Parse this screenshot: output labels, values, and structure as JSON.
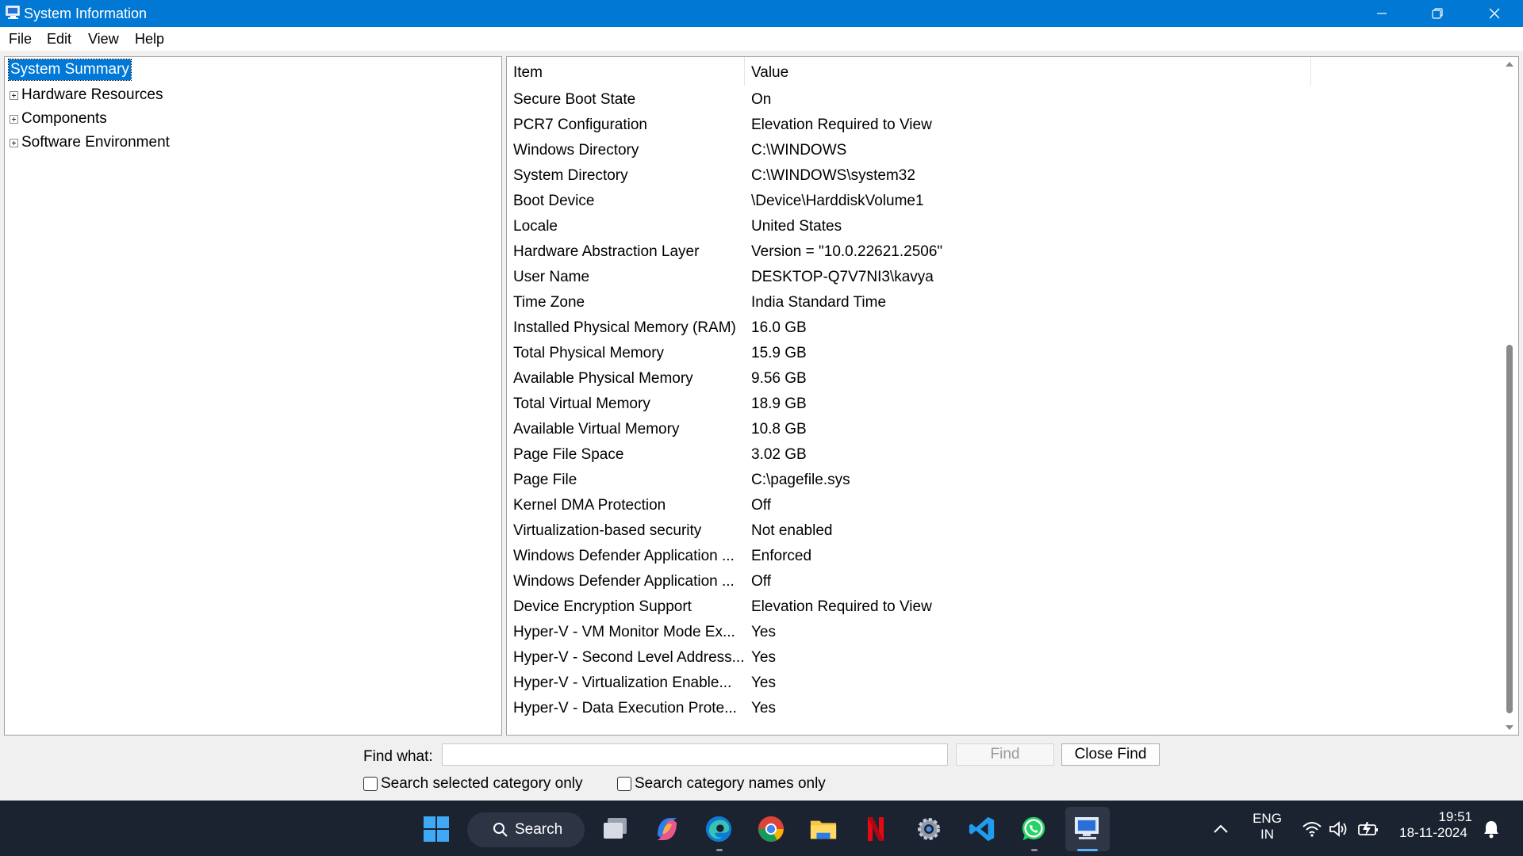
{
  "window": {
    "title": "System Information"
  },
  "menu": {
    "items": [
      "File",
      "Edit",
      "View",
      "Help"
    ]
  },
  "tree": {
    "selected": "System Summary",
    "items": [
      "Hardware Resources",
      "Components",
      "Software Environment"
    ]
  },
  "details": {
    "headers": {
      "item": "Item",
      "value": "Value"
    },
    "rows": [
      {
        "item": "Secure Boot State",
        "value": "On"
      },
      {
        "item": "PCR7 Configuration",
        "value": "Elevation Required to View"
      },
      {
        "item": "Windows Directory",
        "value": "C:\\WINDOWS"
      },
      {
        "item": "System Directory",
        "value": "C:\\WINDOWS\\system32"
      },
      {
        "item": "Boot Device",
        "value": "\\Device\\HarddiskVolume1"
      },
      {
        "item": "Locale",
        "value": "United States"
      },
      {
        "item": "Hardware Abstraction Layer",
        "value": "Version = \"10.0.22621.2506\""
      },
      {
        "item": "User Name",
        "value": "DESKTOP-Q7V7NI3\\kavya"
      },
      {
        "item": "Time Zone",
        "value": "India Standard Time"
      },
      {
        "item": "Installed Physical Memory (RAM)",
        "value": "16.0 GB"
      },
      {
        "item": "Total Physical Memory",
        "value": "15.9 GB"
      },
      {
        "item": "Available Physical Memory",
        "value": "9.56 GB"
      },
      {
        "item": "Total Virtual Memory",
        "value": "18.9 GB"
      },
      {
        "item": "Available Virtual Memory",
        "value": "10.8 GB"
      },
      {
        "item": "Page File Space",
        "value": "3.02 GB"
      },
      {
        "item": "Page File",
        "value": "C:\\pagefile.sys"
      },
      {
        "item": "Kernel DMA Protection",
        "value": "Off"
      },
      {
        "item": "Virtualization-based security",
        "value": "Not enabled"
      },
      {
        "item": "Windows Defender Application ...",
        "value": "Enforced"
      },
      {
        "item": "Windows Defender Application ...",
        "value": "Off"
      },
      {
        "item": "Device Encryption Support",
        "value": "Elevation Required to View"
      },
      {
        "item": "Hyper-V - VM Monitor Mode Ex...",
        "value": "Yes"
      },
      {
        "item": "Hyper-V - Second Level Address...",
        "value": "Yes"
      },
      {
        "item": "Hyper-V - Virtualization Enable...",
        "value": "Yes"
      },
      {
        "item": "Hyper-V - Data Execution Prote...",
        "value": "Yes"
      }
    ]
  },
  "find": {
    "label": "Find what:",
    "value": "",
    "find_button": "Find",
    "close_button": "Close Find",
    "search_selected_label": "Search selected category only",
    "search_names_label": "Search category names only"
  },
  "taskbar": {
    "search_label": "Search",
    "lang_line1": "ENG",
    "lang_line2": "IN",
    "time": "19:51",
    "date": "18-11-2024"
  },
  "colors": {
    "titlebar": "#0078d4",
    "selection": "#0078d7",
    "taskbar": "#1c2330"
  }
}
